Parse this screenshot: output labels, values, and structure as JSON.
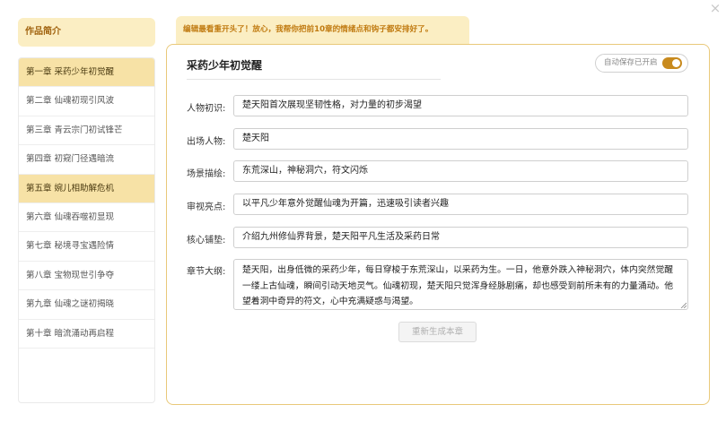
{
  "window": {
    "close_symbol": "×"
  },
  "sidebar": {
    "intro_label": "作品简介",
    "chapters": [
      {
        "label": "第一章 采药少年初觉醒",
        "active": true
      },
      {
        "label": "第二章 仙魂初现引风波",
        "active": false
      },
      {
        "label": "第三章 青云宗门初试锋芒",
        "active": false
      },
      {
        "label": "第四章 初窥门径遇暗流",
        "active": false
      },
      {
        "label": "第五章 婉儿相助解危机",
        "active": true
      },
      {
        "label": "第六章 仙魂吞噬初显现",
        "active": false
      },
      {
        "label": "第七章 秘境寻宝遇险情",
        "active": false
      },
      {
        "label": "第八章 宝物现世引争夺",
        "active": false
      },
      {
        "label": "第九章 仙魂之谜初揭晓",
        "active": false
      },
      {
        "label": "第十章 暗流涌动再启程",
        "active": false
      }
    ]
  },
  "banner": {
    "text": "编辑最看重开头了！放心，我帮你把前10章的情绪点和钩子都安排好了。"
  },
  "editor": {
    "chapter_title": "采药少年初觉醒",
    "autosave_label": "自动保存已开启",
    "fields": {
      "characters_intro": {
        "label": "人物初识:",
        "value": "楚天阳首次展现坚韧性格，对力量的初步渴望"
      },
      "appearing_characters": {
        "label": "出场人物:",
        "value": "楚天阳"
      },
      "scene_description": {
        "label": "场景描绘:",
        "value": "东荒深山，神秘洞穴，符文闪烁"
      },
      "review_highlights": {
        "label": "审视亮点:",
        "value": "以平凡少年意外觉醒仙魂为开篇，迅速吸引读者兴趣"
      },
      "core_setup": {
        "label": "核心铺垫:",
        "value": "介绍九州修仙界背景，楚天阳平凡生活及采药日常"
      },
      "outline": {
        "label": "章节大纲:",
        "value": "楚天阳，出身低微的采药少年，每日穿梭于东荒深山，以采药为生。一日，他意外跌入神秘洞穴，体内突然觉醒一缕上古仙魂，瞬间引动天地灵气。仙魂初现，楚天阳只觉浑身经脉剧痛，却也感受到前所未有的力量涌动。他望着洞中奇异的符文，心中充满疑惑与渴望。"
      }
    },
    "regenerate_label": "重新生成本章"
  },
  "colors": {
    "accent": "#c88a1e",
    "highlight_bg": "#f7e2a6",
    "soft_bg": "#fbeec3",
    "panel_border": "#e9c97a"
  }
}
